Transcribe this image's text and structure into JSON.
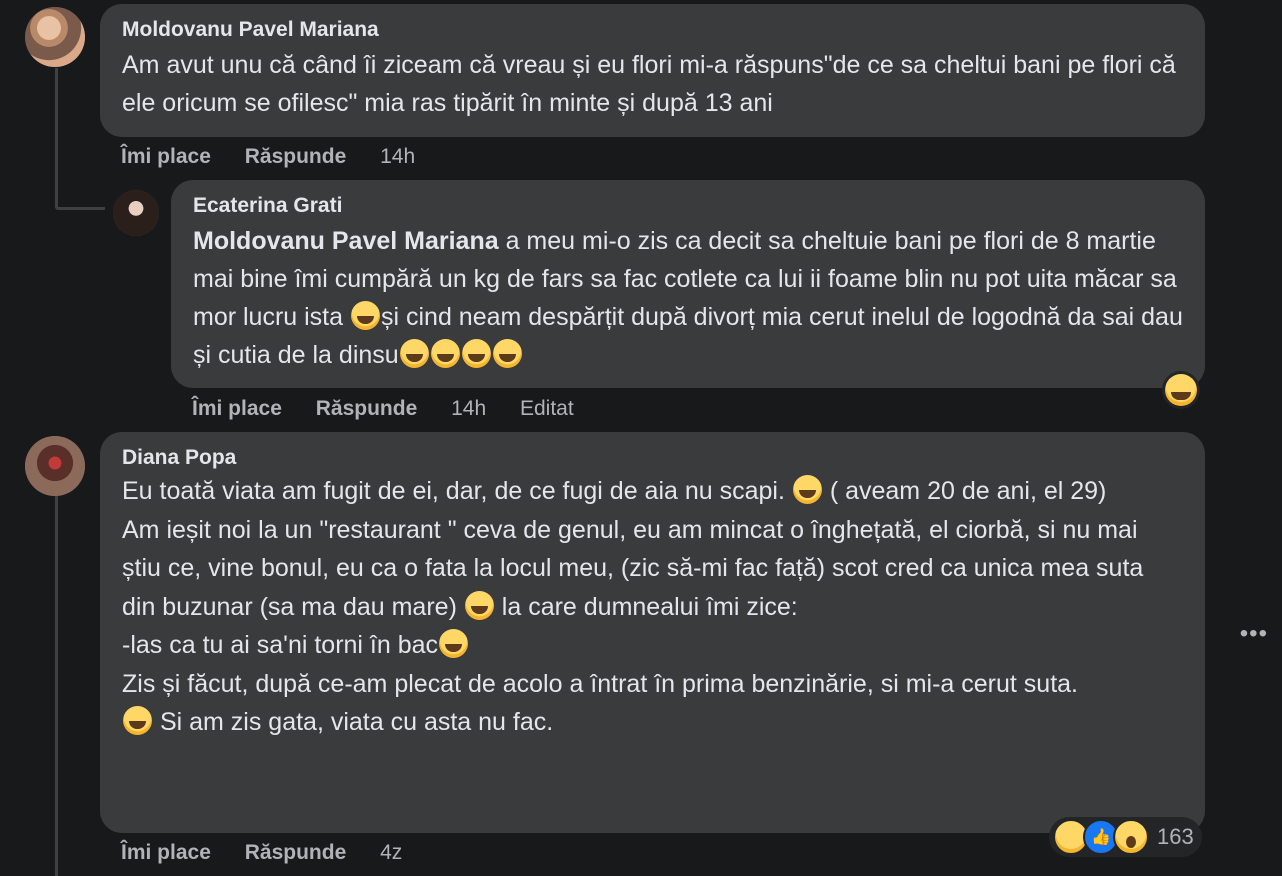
{
  "comments": [
    {
      "author": "Moldovanu Pavel Mariana",
      "text": "Am avut unu că când îi ziceam că vreau și eu flori mi-a răspuns\"de ce sa cheltui bani pe flori că ele oricum se ofilesc\" mia ras tipărit în minte și după 13 ani",
      "like": "Îmi place",
      "reply": "Răspunde",
      "time": "14h"
    },
    {
      "author": "Ecaterina Grati",
      "mention": "Moldovanu Pavel Mariana",
      "text_part1": " a meu mi-o zis ca decit sa cheltuie bani pe flori de 8 martie mai bine îmi cumpără un kg de fars sa fac cotlete ca lui ii foame blin nu pot uita măcar sa mor lucru ista ",
      "text_part2": "și cind neam despărțit după divorț mia cerut inelul de logodnă da sai dau și cutia de la dinsu",
      "like": "Îmi place",
      "reply": "Răspunde",
      "time": "14h",
      "edited": "Editat",
      "reaction_icon": "haha-icon"
    },
    {
      "author": "Diana Popa",
      "line1a": "Eu toată viata am fugit de ei, dar, de ce fugi de aia nu scapi. ",
      "line1b": " ( aveam 20 de ani, el 29)",
      "line2a": "Am ieșit noi la un \"restaurant \" ceva de genul, eu am mincat o înghețată, el ciorbă, si nu mai știu ce, vine bonul, eu ca o fata la locul meu, (zic să-mi fac față) scot cred ca unica mea suta din buzunar (sa ma dau mare) ",
      "line2b": " la care dumnealui îmi zice:",
      "line3": "-las ca tu ai sa'ni torni în bac",
      "line4": "Zis și făcut, după ce-am plecat de acolo a întrat în prima benzinărie, si mi-a cerut suta.",
      "line5": " Si am zis gata, viata cu asta nu fac.",
      "like": "Îmi place",
      "reply": "Răspunde",
      "time": "4z",
      "reaction_count": "163",
      "reaction_icons": [
        "haha-icon",
        "like-icon",
        "wow-icon"
      ]
    }
  ],
  "more_label": "•••"
}
